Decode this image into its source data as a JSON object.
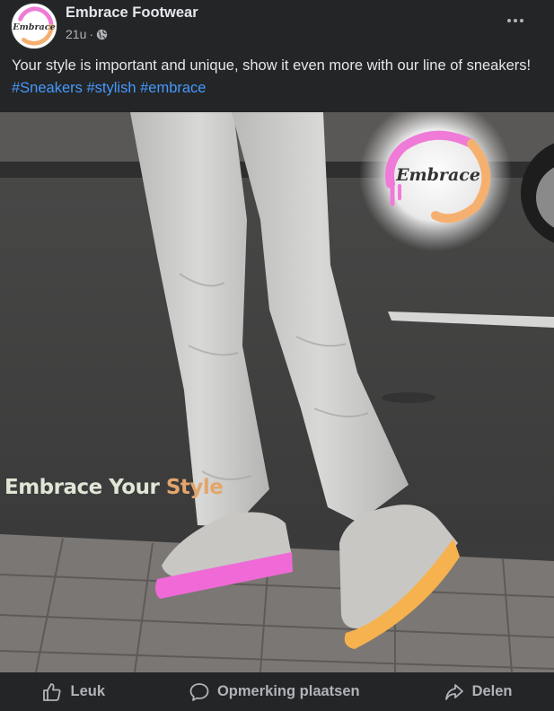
{
  "post": {
    "page_name": "Embrace Footwear",
    "timestamp": "21u",
    "separator": "·",
    "avatar_brand": "Embrace",
    "text": "Your style is important and unique, show it even more with our line of sneakers!",
    "hashtags": [
      "#Sneakers",
      "#stylish",
      "#embrace"
    ]
  },
  "media": {
    "logo_text": "Embrace",
    "slogan_part1": "Embrace Your",
    "slogan_part2": "Style"
  },
  "actions": {
    "like_label": "Leuk",
    "comment_label": "Opmerking plaatsen",
    "share_label": "Delen"
  },
  "colors": {
    "background": "#242526",
    "text": "#e4e6eb",
    "secondary_text": "#b0b3b8",
    "hashtag": "#4599ff",
    "brand_pink": "#ef7ad8",
    "brand_orange": "#f5b070"
  },
  "icons": {
    "privacy": "globe-icon",
    "more": "ellipsis-icon",
    "like": "thumbs-up-icon",
    "comment": "speech-bubble-icon",
    "share": "share-arrow-icon"
  }
}
